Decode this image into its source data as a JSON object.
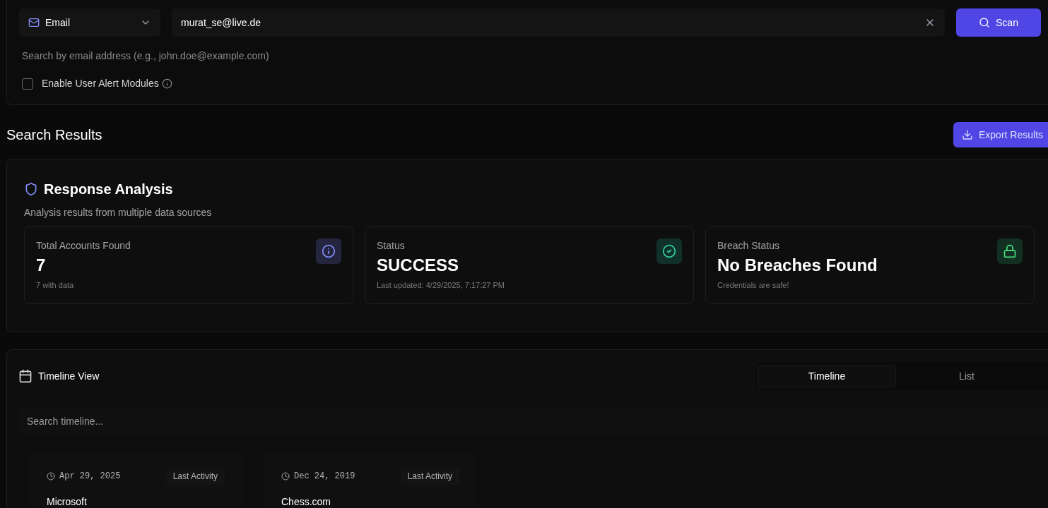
{
  "search": {
    "type_select": {
      "label": "Email"
    },
    "input": {
      "value": "murat_se@live.de"
    },
    "scan_button": "Scan",
    "hint": "Search by email address (e.g., john.doe@example.com)",
    "alert_option": {
      "label": "Enable User Alert Modules",
      "checked": false
    }
  },
  "results": {
    "title": "Search Results",
    "export_button": "Export Results"
  },
  "analysis": {
    "title": "Response Analysis",
    "subtitle": "Analysis results from multiple data sources",
    "cards": [
      {
        "kind": "info",
        "label": "Total Accounts Found",
        "value": "7",
        "note": "7 with data"
      },
      {
        "kind": "success",
        "label": "Status",
        "value": "SUCCESS",
        "note": "Last updated: 4/29/2025, 7:17:27 PM"
      },
      {
        "kind": "secure",
        "label": "Breach Status",
        "value": "No Breaches Found",
        "note": "Credentials are safe!"
      }
    ]
  },
  "timeline": {
    "title": "Timeline View",
    "tabs": [
      {
        "label": "Timeline",
        "selected": true
      },
      {
        "label": "List",
        "selected": false
      }
    ],
    "search": {
      "placeholder": "Search timeline..."
    },
    "events": [
      {
        "date": "Apr 29, 2025",
        "tag": "Last Activity",
        "name": "Microsoft"
      },
      {
        "date": "Dec 24, 2019",
        "tag": "Last Activity",
        "name": "Chess.com"
      }
    ]
  }
}
